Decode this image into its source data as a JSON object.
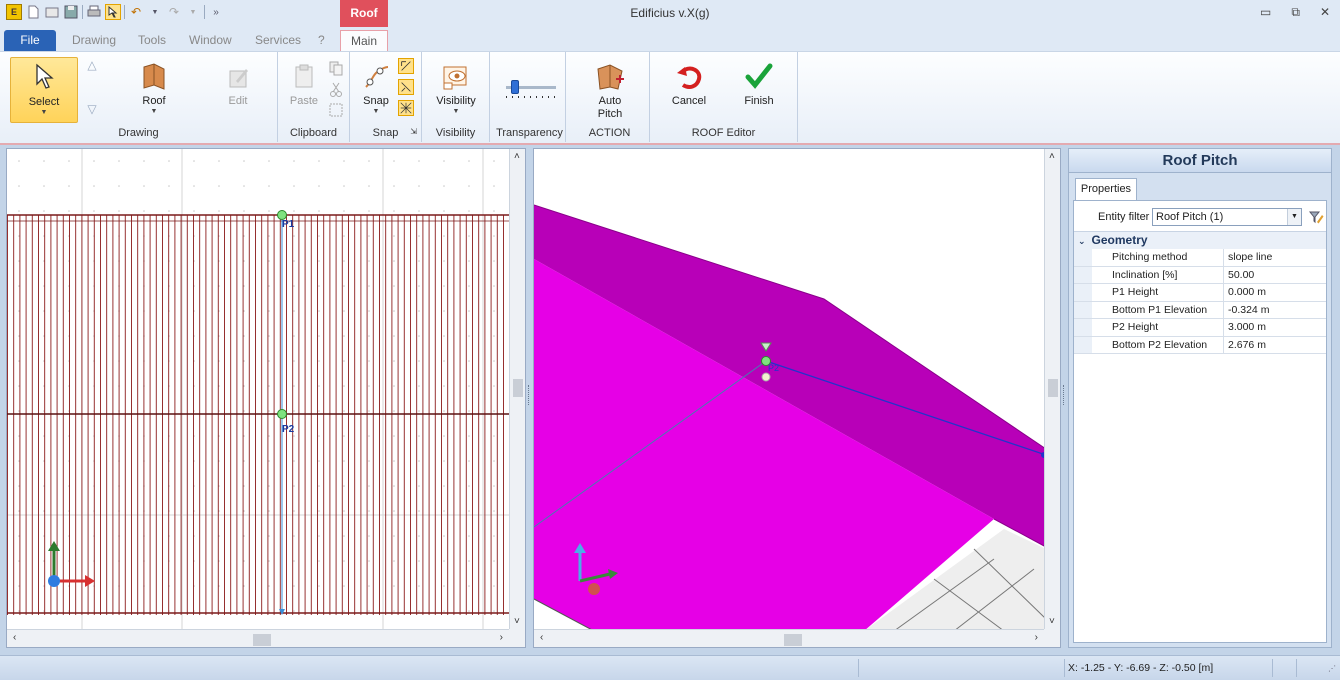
{
  "app": {
    "title": "Edificius v.X(g)",
    "context_tab_header": "Roof"
  },
  "quick_access": {
    "icons": [
      "app-icon",
      "new-icon",
      "open-icon",
      "save-icon",
      "print-icon",
      "select-icon",
      "undo-icon",
      "redo-icon",
      "more-icon"
    ]
  },
  "tabs": {
    "file": "File",
    "items": [
      "Drawing",
      "Tools",
      "Window",
      "Services",
      "?"
    ],
    "main": "Main"
  },
  "ribbon": {
    "drawing": {
      "label": "Drawing",
      "select": "Select",
      "roof": "Roof",
      "edit": "Edit"
    },
    "clipboard": {
      "label": "Clipboard",
      "paste": "Paste"
    },
    "snap": {
      "label": "Snap",
      "snap": "Snap"
    },
    "visibility": {
      "label": "Visibility",
      "visibility": "Visibility"
    },
    "transparency": {
      "label": "Transparency",
      "level": 0.12
    },
    "action": {
      "label": "ACTION",
      "auto_pitch_line1": "Auto",
      "auto_pitch_line2": "Pitch"
    },
    "roof_editor": {
      "label": "ROOF Editor",
      "cancel": "Cancel",
      "finish": "Finish"
    },
    "colors": {
      "cancel": "#d42020",
      "finish": "#1aa33a",
      "active": "#ffd35a"
    }
  },
  "view2d": {
    "points": [
      "P1",
      "P2"
    ],
    "colors": {
      "lines": "#8b1a1a",
      "slope": "#3b8fd9",
      "point": "#7fe27f"
    }
  },
  "view3d": {
    "points": [
      "P2"
    ],
    "colors": {
      "roof_top": "#b800b8",
      "roof_front": "#e600e6",
      "slope_line": "#2233cc"
    }
  },
  "properties": {
    "title": "Roof Pitch",
    "tab": "Properties",
    "filter_label": "Entity filter",
    "filter_value": "Roof Pitch (1)",
    "category": "Geometry",
    "rows": [
      {
        "name": "Pitching method",
        "value": "slope line"
      },
      {
        "name": "Inclination  [%]",
        "value": "50.00"
      },
      {
        "name": "P1 Height",
        "value": "0.000 m"
      },
      {
        "name": "Bottom P1 Elevation",
        "value": "-0.324 m"
      },
      {
        "name": "P2 Height",
        "value": "3.000 m"
      },
      {
        "name": "Bottom P2 Elevation",
        "value": "2.676 m"
      }
    ]
  },
  "status": {
    "coords": "X: -1.25 - Y: -6.69 - Z: -0.50 [m]"
  }
}
